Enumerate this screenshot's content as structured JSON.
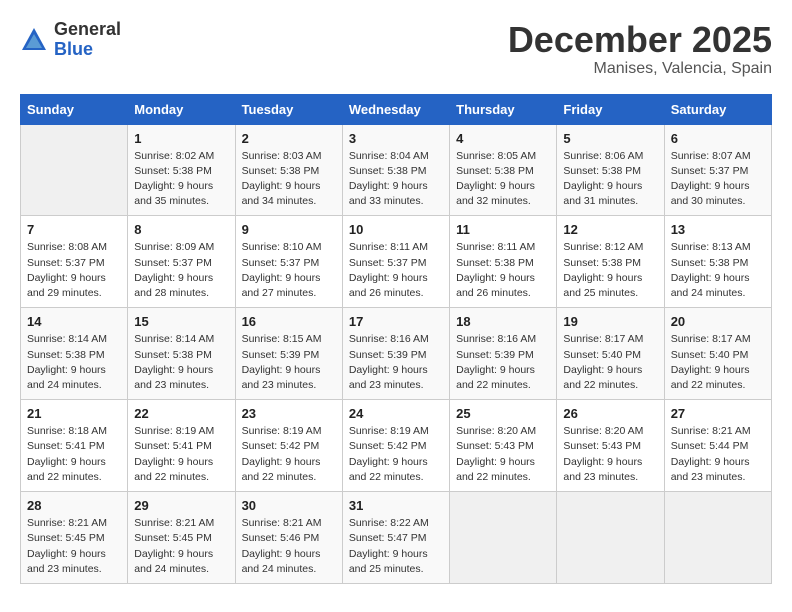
{
  "header": {
    "logo_general": "General",
    "logo_blue": "Blue",
    "month_title": "December 2025",
    "location": "Manises, Valencia, Spain"
  },
  "calendar": {
    "days_of_week": [
      "Sunday",
      "Monday",
      "Tuesday",
      "Wednesday",
      "Thursday",
      "Friday",
      "Saturday"
    ],
    "weeks": [
      [
        {
          "day": "",
          "info": ""
        },
        {
          "day": "1",
          "info": "Sunrise: 8:02 AM\nSunset: 5:38 PM\nDaylight: 9 hours\nand 35 minutes."
        },
        {
          "day": "2",
          "info": "Sunrise: 8:03 AM\nSunset: 5:38 PM\nDaylight: 9 hours\nand 34 minutes."
        },
        {
          "day": "3",
          "info": "Sunrise: 8:04 AM\nSunset: 5:38 PM\nDaylight: 9 hours\nand 33 minutes."
        },
        {
          "day": "4",
          "info": "Sunrise: 8:05 AM\nSunset: 5:38 PM\nDaylight: 9 hours\nand 32 minutes."
        },
        {
          "day": "5",
          "info": "Sunrise: 8:06 AM\nSunset: 5:38 PM\nDaylight: 9 hours\nand 31 minutes."
        },
        {
          "day": "6",
          "info": "Sunrise: 8:07 AM\nSunset: 5:37 PM\nDaylight: 9 hours\nand 30 minutes."
        }
      ],
      [
        {
          "day": "7",
          "info": "Sunrise: 8:08 AM\nSunset: 5:37 PM\nDaylight: 9 hours\nand 29 minutes."
        },
        {
          "day": "8",
          "info": "Sunrise: 8:09 AM\nSunset: 5:37 PM\nDaylight: 9 hours\nand 28 minutes."
        },
        {
          "day": "9",
          "info": "Sunrise: 8:10 AM\nSunset: 5:37 PM\nDaylight: 9 hours\nand 27 minutes."
        },
        {
          "day": "10",
          "info": "Sunrise: 8:11 AM\nSunset: 5:37 PM\nDaylight: 9 hours\nand 26 minutes."
        },
        {
          "day": "11",
          "info": "Sunrise: 8:11 AM\nSunset: 5:38 PM\nDaylight: 9 hours\nand 26 minutes."
        },
        {
          "day": "12",
          "info": "Sunrise: 8:12 AM\nSunset: 5:38 PM\nDaylight: 9 hours\nand 25 minutes."
        },
        {
          "day": "13",
          "info": "Sunrise: 8:13 AM\nSunset: 5:38 PM\nDaylight: 9 hours\nand 24 minutes."
        }
      ],
      [
        {
          "day": "14",
          "info": "Sunrise: 8:14 AM\nSunset: 5:38 PM\nDaylight: 9 hours\nand 24 minutes."
        },
        {
          "day": "15",
          "info": "Sunrise: 8:14 AM\nSunset: 5:38 PM\nDaylight: 9 hours\nand 23 minutes."
        },
        {
          "day": "16",
          "info": "Sunrise: 8:15 AM\nSunset: 5:39 PM\nDaylight: 9 hours\nand 23 minutes."
        },
        {
          "day": "17",
          "info": "Sunrise: 8:16 AM\nSunset: 5:39 PM\nDaylight: 9 hours\nand 23 minutes."
        },
        {
          "day": "18",
          "info": "Sunrise: 8:16 AM\nSunset: 5:39 PM\nDaylight: 9 hours\nand 22 minutes."
        },
        {
          "day": "19",
          "info": "Sunrise: 8:17 AM\nSunset: 5:40 PM\nDaylight: 9 hours\nand 22 minutes."
        },
        {
          "day": "20",
          "info": "Sunrise: 8:17 AM\nSunset: 5:40 PM\nDaylight: 9 hours\nand 22 minutes."
        }
      ],
      [
        {
          "day": "21",
          "info": "Sunrise: 8:18 AM\nSunset: 5:41 PM\nDaylight: 9 hours\nand 22 minutes."
        },
        {
          "day": "22",
          "info": "Sunrise: 8:19 AM\nSunset: 5:41 PM\nDaylight: 9 hours\nand 22 minutes."
        },
        {
          "day": "23",
          "info": "Sunrise: 8:19 AM\nSunset: 5:42 PM\nDaylight: 9 hours\nand 22 minutes."
        },
        {
          "day": "24",
          "info": "Sunrise: 8:19 AM\nSunset: 5:42 PM\nDaylight: 9 hours\nand 22 minutes."
        },
        {
          "day": "25",
          "info": "Sunrise: 8:20 AM\nSunset: 5:43 PM\nDaylight: 9 hours\nand 22 minutes."
        },
        {
          "day": "26",
          "info": "Sunrise: 8:20 AM\nSunset: 5:43 PM\nDaylight: 9 hours\nand 23 minutes."
        },
        {
          "day": "27",
          "info": "Sunrise: 8:21 AM\nSunset: 5:44 PM\nDaylight: 9 hours\nand 23 minutes."
        }
      ],
      [
        {
          "day": "28",
          "info": "Sunrise: 8:21 AM\nSunset: 5:45 PM\nDaylight: 9 hours\nand 23 minutes."
        },
        {
          "day": "29",
          "info": "Sunrise: 8:21 AM\nSunset: 5:45 PM\nDaylight: 9 hours\nand 24 minutes."
        },
        {
          "day": "30",
          "info": "Sunrise: 8:21 AM\nSunset: 5:46 PM\nDaylight: 9 hours\nand 24 minutes."
        },
        {
          "day": "31",
          "info": "Sunrise: 8:22 AM\nSunset: 5:47 PM\nDaylight: 9 hours\nand 25 minutes."
        },
        {
          "day": "",
          "info": ""
        },
        {
          "day": "",
          "info": ""
        },
        {
          "day": "",
          "info": ""
        }
      ]
    ]
  }
}
